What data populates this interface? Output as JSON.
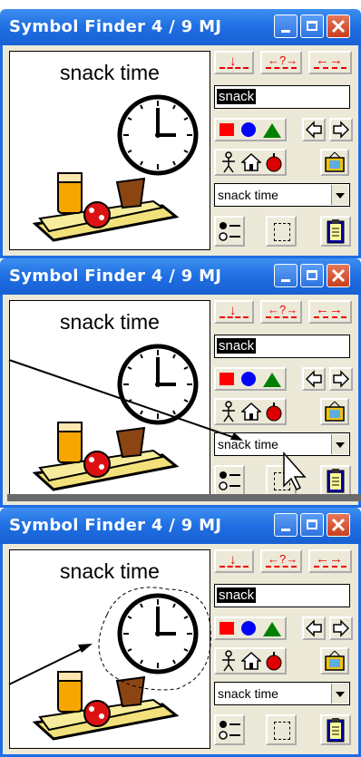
{
  "app": {
    "title": "Symbol Finder  4 / 9   MJ"
  },
  "canvas": {
    "label": "snack time"
  },
  "search": {
    "value": "snack"
  },
  "dropdown": {
    "selected": "snack time"
  },
  "tool_buttons": {
    "link_down": "↓",
    "link_query": "←?→",
    "link_both": "←→"
  },
  "colors": {
    "title_bar": "#1f6ee3",
    "background": "#ece9d8",
    "accent_red": "#ff0000",
    "accent_blue": "#0000ff",
    "accent_green": "#008000"
  }
}
